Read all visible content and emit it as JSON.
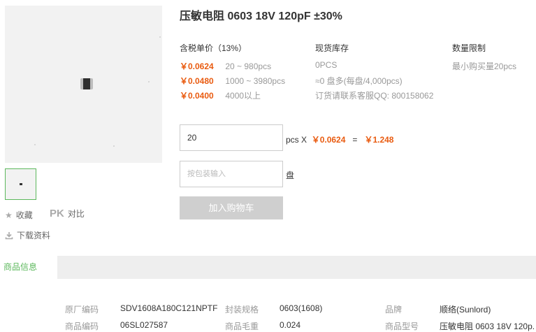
{
  "product": {
    "title": "压敏电阻 0603 18V 120pF ±30%"
  },
  "gallery": {
    "main_image_alt": "product-image",
    "thumbnail_alt": "thumbnail"
  },
  "actions": {
    "favorite_label": "收藏",
    "compare_badge": "PK",
    "compare_label": "对比",
    "download_label": "下载资料"
  },
  "pricing": {
    "header": "含税单价（13%）",
    "tiers": [
      {
        "price": "￥0.0624",
        "range": "20 ~ 980pcs"
      },
      {
        "price": "￥0.0480",
        "range": "1000 ~ 3980pcs"
      },
      {
        "price": "￥0.0400",
        "range": "4000以上"
      }
    ]
  },
  "stock": {
    "header": "现货库存",
    "quantity": "0PCS",
    "reels": "≈0 盘多(每盘/4,000pcs)",
    "contact": "订货请联系客服QQ: 800158062"
  },
  "limit": {
    "header": "数量限制",
    "min": "最小购买量20pcs"
  },
  "order": {
    "qty_value": "20",
    "unit": "pcs X",
    "unit_price": "￥0.0624",
    "equals": "=",
    "total": "￥1.248",
    "reel_placeholder": "按包装输入",
    "reel_unit": "盘",
    "add_to_cart": "加入购物车"
  },
  "tabs": {
    "active": "商品信息"
  },
  "specs": {
    "rows": [
      [
        {
          "label": "原厂编码",
          "value": "SDV1608A180C121NPTF"
        },
        {
          "label": "封装规格",
          "value": "0603(1608)"
        },
        {
          "label": "品牌",
          "value": "顺络(Sunlord)"
        }
      ],
      [
        {
          "label": "商品编码",
          "value": "06SL027587"
        },
        {
          "label": "商品毛重",
          "value": "0.024"
        },
        {
          "label": "商品型号",
          "value": "压敏电阻 0603 18V 120p."
        }
      ]
    ]
  },
  "colors": {
    "accent_orange": "#e95b10",
    "accent_green": "#5cb85c",
    "button_disabled": "#cfcfcf"
  }
}
